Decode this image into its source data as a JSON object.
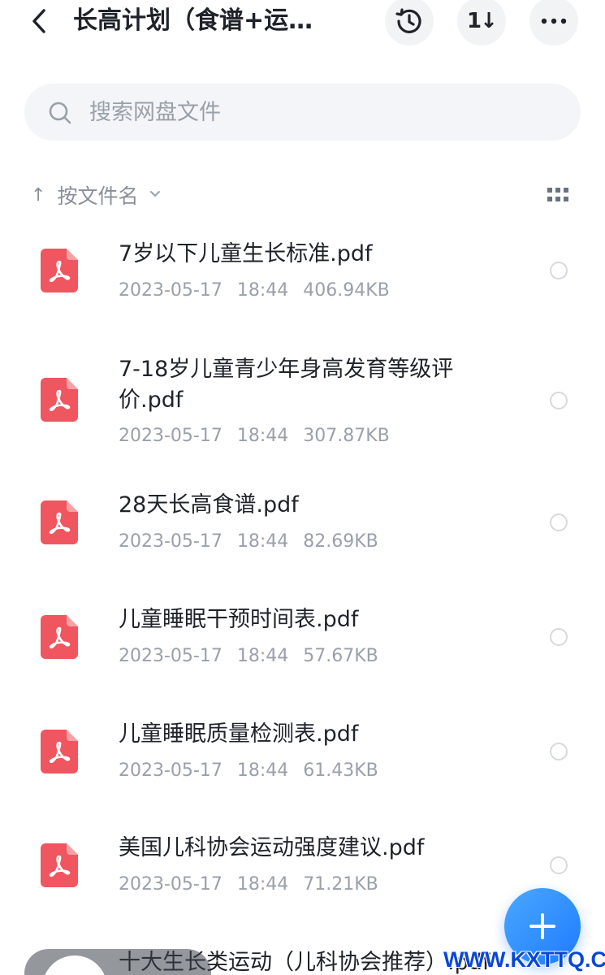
{
  "header": {
    "title": "长高计划（食谱+运…",
    "history_icon": "history-icon",
    "sort_icon": "sort-toggle-icon",
    "sort_glyph": "1↓",
    "more_icon": "more-icon",
    "more_glyph": "•••"
  },
  "search": {
    "placeholder": "搜索网盘文件",
    "value": ""
  },
  "sort": {
    "label": "按文件名"
  },
  "colors": {
    "accent": "#1e7bff",
    "pdf": "#f0565f",
    "text": "#1f2329",
    "meta": "#9aa0aa"
  },
  "files": [
    {
      "name": "7岁以下儿童生长标准.pdf",
      "date": "2023-05-17",
      "time": "18:44",
      "size": "406.94KB"
    },
    {
      "name": "7-18岁儿童青少年身高发育等级评价.pdf",
      "date": "2023-05-17",
      "time": "18:44",
      "size": "307.87KB"
    },
    {
      "name": "28天长高食谱.pdf",
      "date": "2023-05-17",
      "time": "18:44",
      "size": "82.69KB"
    },
    {
      "name": "儿童睡眠干预时间表.pdf",
      "date": "2023-05-17",
      "time": "18:44",
      "size": "57.67KB"
    },
    {
      "name": "儿童睡眠质量检测表.pdf",
      "date": "2023-05-17",
      "time": "18:44",
      "size": "61.43KB"
    },
    {
      "name": "美国儿科协会运动强度建议.pdf",
      "date": "2023-05-17",
      "time": "18:44",
      "size": "71.21KB"
    },
    {
      "name": "十大生长类运动（儿科协会推荐）.pdf"
    }
  ],
  "watermark": "WWW.KXTTQ.COM"
}
